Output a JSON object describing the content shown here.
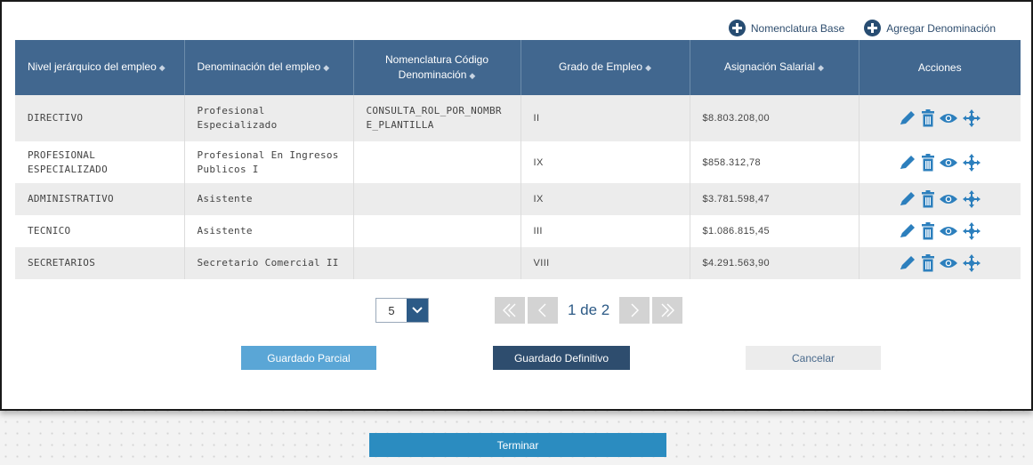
{
  "top_links": {
    "base": "Nomenclatura Base",
    "add": "Agregar Denominación"
  },
  "table": {
    "headers": [
      "Nivel jerárquico del empleo",
      "Denominación del empleo",
      "Nomenclatura Código Denominación",
      "Grado de Empleo",
      "Asignación Salarial",
      "Acciones"
    ],
    "rows": [
      {
        "nivel": "DIRECTIVO",
        "denominacion": "Profesional Especializado",
        "nomenclatura": "CONSULTA_ROL_POR_NOMBRE_PLANTILLA",
        "grado": "II",
        "asignacion": "$8.803.208,00"
      },
      {
        "nivel": "PROFESIONAL ESPECIALIZADO",
        "denominacion": "Profesional En Ingresos Publicos I",
        "nomenclatura": "",
        "grado": "IX",
        "asignacion": "$858.312,78"
      },
      {
        "nivel": "ADMINISTRATIVO",
        "denominacion": "Asistente",
        "nomenclatura": "",
        "grado": "IX",
        "asignacion": "$3.781.598,47"
      },
      {
        "nivel": "TECNICO",
        "denominacion": "Asistente",
        "nomenclatura": "",
        "grado": "III",
        "asignacion": "$1.086.815,45"
      },
      {
        "nivel": "SECRETARIOS",
        "denominacion": "Secretario Comercial II",
        "nomenclatura": "",
        "grado": "VIII",
        "asignacion": "$4.291.563,90"
      }
    ]
  },
  "pagination": {
    "page_size": "5",
    "page_label": "1 de 2"
  },
  "buttons": {
    "partial": "Guardado Parcial",
    "final": "Guardado Definitivo",
    "cancel": "Cancelar",
    "finish": "Terminar"
  },
  "colors": {
    "header_bg": "#41678f",
    "accent_dark": "#2e4d6e",
    "accent_light": "#5aa6d6",
    "icon_blue": "#2c7fbd"
  },
  "icons": {
    "edit": "pencil-icon",
    "delete": "trash-icon",
    "view": "eye-icon",
    "move": "move-icon"
  }
}
